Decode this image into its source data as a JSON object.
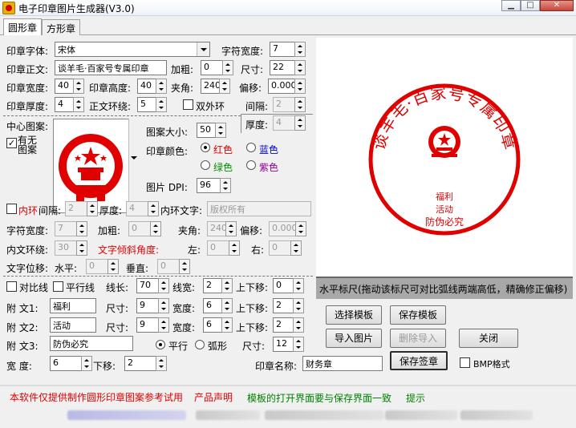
{
  "window": {
    "title": "电子印章图片生成器(V3.0)",
    "min": "▁",
    "max": "□",
    "close": "✕"
  },
  "tabs": [
    "圆形章",
    "方形章"
  ],
  "row1": {
    "font_label": "印章字体:",
    "font_value": "宋体",
    "char_width_label": "字符宽度:",
    "char_width": "7"
  },
  "row2": {
    "text_label": "印章正文:",
    "text_value": "谈羊毛·百家号专属印章",
    "bold_label": "加粗:",
    "bold": "0",
    "size_label": "尺寸:",
    "size": "22"
  },
  "row3": {
    "width_label": "印章宽度:",
    "width": "40",
    "height_label": "印章高度:",
    "height": "40",
    "angle_label": "夹角:",
    "angle": "240",
    "offset_label": "偏移:",
    "offset": "0.000"
  },
  "row4": {
    "thickness_label": "印章厚度:",
    "thickness": "4",
    "ring_label": "正文环绕:",
    "ring": "5",
    "double_label": "双外环",
    "gap_label": "间隔:",
    "gap": "2",
    "depth_label": "厚度:",
    "depth": "4"
  },
  "center": {
    "label": "中心图案:",
    "has_label_1": "有无",
    "has_label_2": "图案",
    "has_checked": "✓",
    "img_size_label": "图案大小:",
    "img_size": "50",
    "color_label": "印章颜色:",
    "colors": [
      {
        "name": "红色",
        "color": "#e00000",
        "on": true
      },
      {
        "name": "蓝色",
        "color": "#0000e0",
        "on": false
      },
      {
        "name": "绿色",
        "color": "#009000",
        "on": false
      },
      {
        "name": "紫色",
        "color": "#900090",
        "on": false
      }
    ],
    "dpi_label": "图片 DPI:",
    "dpi": "96"
  },
  "inner": {
    "ring_label": "内环",
    "gap_label": "间隔:",
    "gap": "2",
    "depth_label": "厚度:",
    "depth": "4",
    "text_label": "内环文字:",
    "text": "版权所有",
    "cw_label": "字符宽度:",
    "cw": "7",
    "bold_label": "加粗:",
    "bold": "0",
    "angle_label": "夹角:",
    "angle": "240",
    "offset_label": "偏移:",
    "offset": "0.000",
    "wrap_label": "内文环绕:",
    "wrap": "30",
    "tilt_label": "文字倾斜角度:",
    "left_label": "左:",
    "left": "0",
    "right_label": "右:",
    "right": "0",
    "shift_label": "文字位移:",
    "h_label": "水平:",
    "h": "0",
    "v_label": "垂直:",
    "v": "0"
  },
  "lines": {
    "compare_label": "对比线",
    "parallel_label": "平行线",
    "len_label": "线长:",
    "len": "70",
    "lw_label": "线宽:",
    "lw": "2",
    "ud_label": "上下移:",
    "ud": "0"
  },
  "aux": [
    {
      "label": "附  文1:",
      "value": "福利",
      "size_label": "尺寸:",
      "size": "9",
      "w_label": "宽度:",
      "w": "6",
      "ud_label": "上下移:",
      "ud": "2"
    },
    {
      "label": "附  文2:",
      "value": "活动",
      "size_label": "尺寸:",
      "size": "9",
      "w_label": "宽度:",
      "w": "6",
      "ud_label": "上下移:",
      "ud": "2"
    }
  ],
  "aux3": {
    "label": "附  文3:",
    "value": "防伪必究",
    "parallel_label": "平行",
    "arc_label": "弧形",
    "size_label": "尺寸:",
    "size": "12"
  },
  "bottom": {
    "width_label": "宽   度:",
    "width": "6",
    "ud_label": "下移:",
    "ud": "2",
    "name_label": "印章名称:",
    "name": "财务章",
    "bmp_label": "BMP格式"
  },
  "buttons": {
    "select_template": "选择模板",
    "save_template": "保存模板",
    "import_image": "导入图片",
    "delete_import": "删除导入",
    "close": "关闭",
    "save_seal": "保存签章"
  },
  "ruler": "水平标尺(拖动该标尺可对比弧线两端高低，精确修正偏移)",
  "footer": {
    "notice": "本软件仅提供制作圆形印章图案参考试用",
    "statement": "产品声明",
    "hint": "模板的打开界面要与保存界面一致",
    "tips": "提示"
  },
  "stamp": {
    "ring_text": "谈羊毛·百家号专属印章",
    "line1": "福利",
    "line2": "活动",
    "line3": "防伪必究",
    "color": "#e00000"
  }
}
